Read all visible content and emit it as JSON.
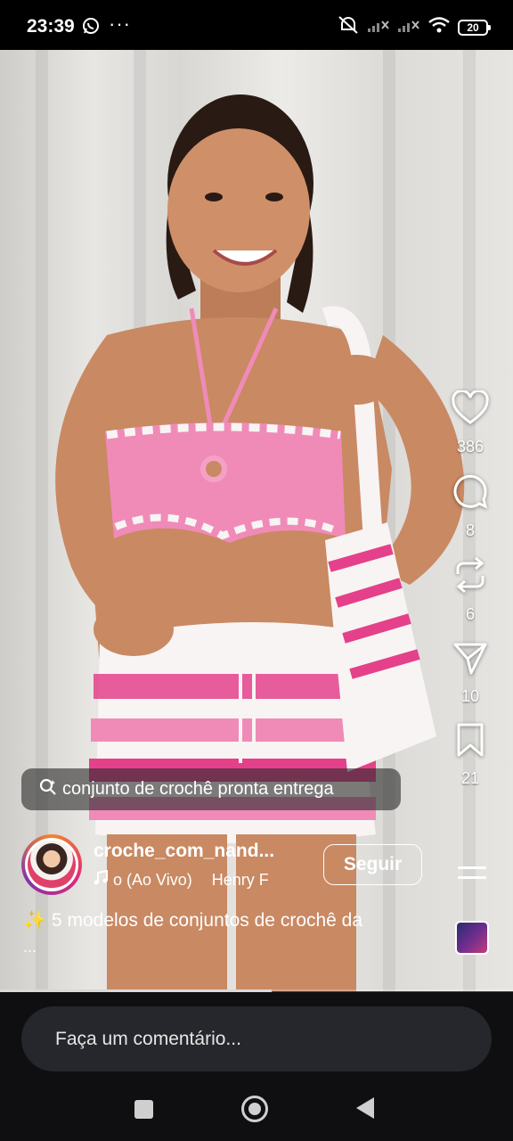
{
  "status_bar": {
    "time": "23:39",
    "dots": "···",
    "battery": "20"
  },
  "reel": {
    "likes": "386",
    "comments": "8",
    "reposts": "6",
    "shares": "10",
    "saves": "21"
  },
  "search_chip": {
    "label": "conjunto de crochê pronta entrega"
  },
  "author": {
    "username": "croche_com_nand...",
    "music": "o (Ao Vivo)",
    "music_artist": "Henry F",
    "follow_label": "Seguir"
  },
  "caption": {
    "text": "✨ 5 modelos de conjuntos de crochê da",
    "more": "..."
  },
  "progress": {
    "fraction": 0.53
  },
  "comment_input": {
    "placeholder": "Faça um comentário..."
  },
  "colors": {
    "pink": "#f08bb8",
    "hot_pink": "#e4418a",
    "white_yarn": "#f8f4f3",
    "skin": "#c98963"
  }
}
